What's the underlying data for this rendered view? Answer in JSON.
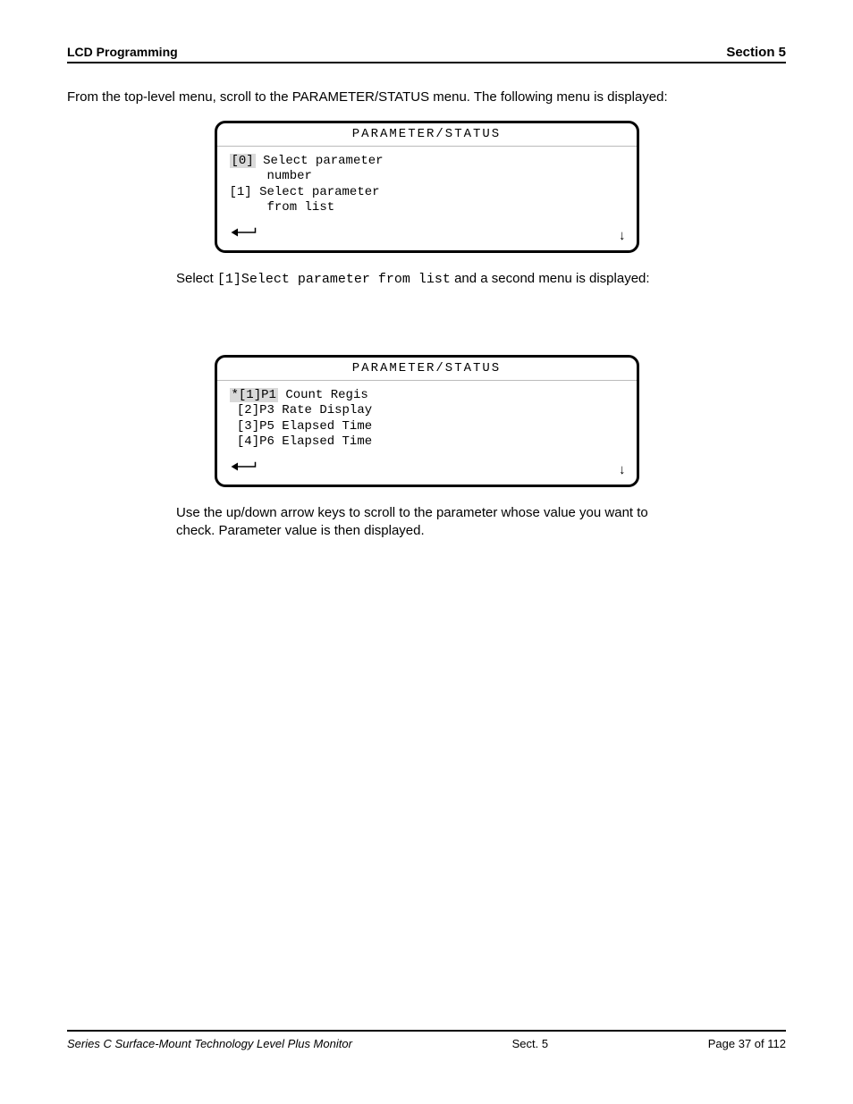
{
  "header": {
    "left": "LCD Programming",
    "right": "Section 5"
  },
  "intro": "From the top-level menu, scroll to the PARAMETER/STATUS menu. The following menu is displayed:",
  "panel1": {
    "title": "PARAMETER/STATUS",
    "line1_hl": "[0]",
    "line1_rest": "Select parameter",
    "line2": "     number",
    "line3": "[1] Select parameter",
    "line4": "     from list"
  },
  "caption1": {
    "text_a": "Select ",
    "code": "[1]Select parameter from list",
    "text_b": " and a second menu is displayed:"
  },
  "panel2": {
    "title": "PARAMETER/STATUS",
    "line1_hl": "*[1]P1",
    "line1_rest": "Count Regis",
    "line2": " [2]P3 Rate Display",
    "line3": " [3]P5 Elapsed Time",
    "line4": " [4]P6 Elapsed Time"
  },
  "caption2": "Use the up/down arrow keys to scroll to the parameter whose value you want to check. Parameter value is then displayed.",
  "footer": {
    "left": "Series C Surface-Mount Technology Level Plus Monitor",
    "section": "Sect. 5",
    "pages": "Page 37 of 112"
  }
}
